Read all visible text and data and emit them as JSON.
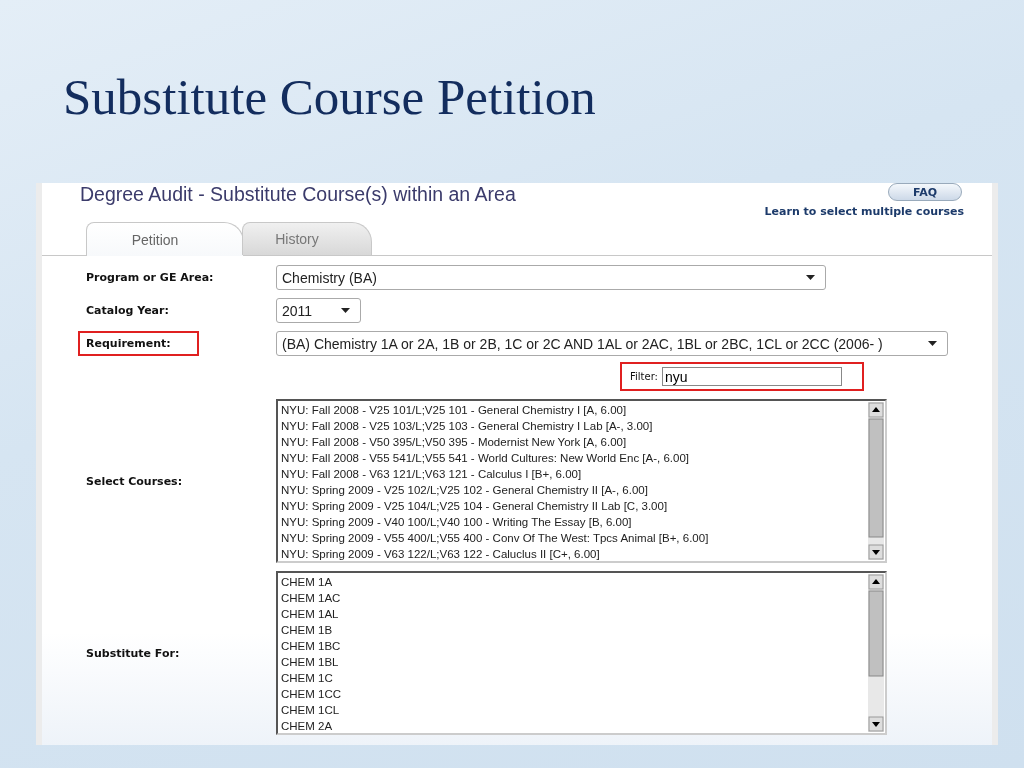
{
  "slide": {
    "title": "Substitute Course Petition"
  },
  "page": {
    "title": "Degree Audit - Substitute Course(s) within an Area",
    "faq_button": "FAQ",
    "help_link": "Learn to select multiple courses"
  },
  "tabs": [
    {
      "label": "Petition",
      "selected": true
    },
    {
      "label": "History",
      "selected": false
    }
  ],
  "fields": [
    {
      "label": "Program or GE Area:",
      "value": "Chemistry (BA)",
      "highlighted": false
    },
    {
      "label": "Catalog Year:",
      "value": "2011",
      "highlighted": false
    },
    {
      "label": "Requirement:",
      "value": "(BA) Chemistry 1A or 2A, 1B or 2B, 1C or 2C AND 1AL or 2AC, 1BL or 2BC, 1CL or 2CC (2006- )",
      "highlighted": true
    }
  ],
  "filter": {
    "label": "Filter:",
    "value": "nyu",
    "highlighted": true
  },
  "lists": [
    {
      "label": "Select Courses:",
      "items": [
        "NYU: Fall 2008 - V25 101/L;V25 101 - General Chemistry I [A, 6.00]",
        "NYU: Fall 2008 - V25 103/L;V25 103 - General Chemistry I Lab [A-, 3.00]",
        "NYU: Fall 2008 - V50 395/L;V50 395 - Modernist New York [A, 6.00]",
        "NYU: Fall 2008 - V55 541/L;V55 541 - World Cultures: New World Enc [A-, 6.00]",
        "NYU: Fall 2008 - V63 121/L;V63 121 - Calculus I [B+, 6.00]",
        "NYU: Spring 2009 - V25 102/L;V25 102 - General Chemistry II [A-, 6.00]",
        "NYU: Spring 2009 - V25 104/L;V25 104 - General Chemistry II Lab [C, 3.00]",
        "NYU: Spring 2009 - V40 100/L;V40 100 - Writing The Essay [B, 6.00]",
        "NYU: Spring 2009 - V55 400/L;V55 400 - Conv Of The West: Tpcs Animal [B+, 6.00]",
        "NYU: Spring 2009 - V63 122/L;V63 122 - Caluclus II [C+, 6.00]"
      ]
    },
    {
      "label": "Substitute For:",
      "items": [
        "CHEM 1A",
        "CHEM 1AC",
        "CHEM 1AL",
        "CHEM 1B",
        "CHEM 1BC",
        "CHEM 1BL",
        "CHEM 1C",
        "CHEM 1CC",
        "CHEM 1CL",
        "CHEM 2A"
      ]
    }
  ]
}
